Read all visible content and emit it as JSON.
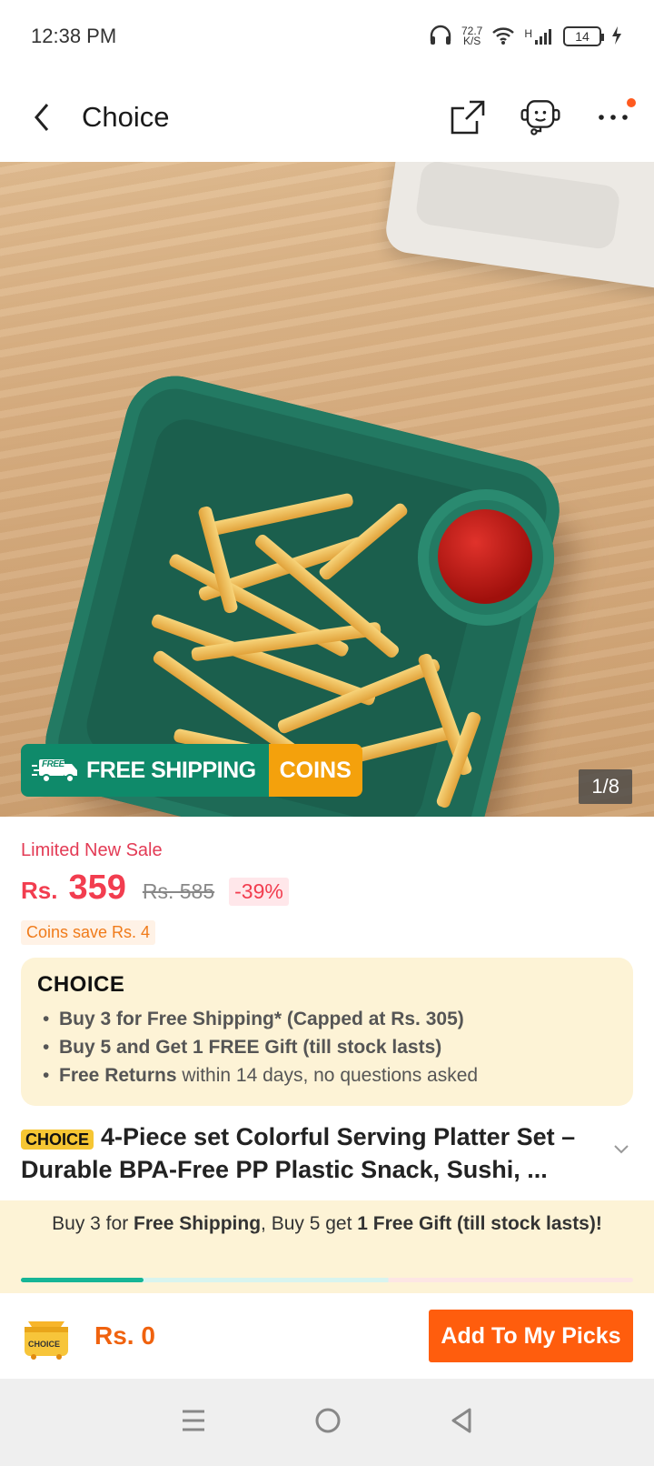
{
  "status_bar": {
    "time": "12:38 PM",
    "speed_value": "72.7",
    "speed_unit": "K/S",
    "network": "H",
    "battery": "14"
  },
  "navbar": {
    "title": "Choice"
  },
  "gallery": {
    "counter": "1/8",
    "free_shipping_label": "FREE SHIPPING",
    "free_tag": "FREE",
    "coins_label": "COINS"
  },
  "pricing": {
    "sale_label": "Limited New Sale",
    "currency": "Rs.",
    "price": "359",
    "original_price": "Rs. 585",
    "discount": "-39%",
    "coins_save": "Coins save Rs. 4"
  },
  "choice_box": {
    "logo": "CHOICE",
    "items": [
      {
        "bold": "Buy 3 for  Free Shipping* (Capped at Rs. 305)",
        "rest": ""
      },
      {
        "bold": "Buy 5 and Get 1 FREE Gift (till stock lasts)",
        "rest": ""
      },
      {
        "bold": "Free Returns",
        "rest": " within 14 days, no questions asked"
      }
    ]
  },
  "product": {
    "tag": "CHOICE",
    "title": "4-Piece set Colorful Serving Platter Set – Durable BPA-Free PP Plastic Snack, Sushi, ..."
  },
  "promo_banner": {
    "part1": "Buy 3 for ",
    "bold1": "Free Shipping",
    "part2": ", Buy 5 get ",
    "bold2": "1 Free Gift (till stock lasts)!",
    "progress": 0.2
  },
  "cart_bar": {
    "cart_icon_label": "CHOICE",
    "total": "Rs. 0",
    "add_button": "Add To My Picks"
  },
  "colors": {
    "accent": "#ff5d0d",
    "price": "#f23d4f",
    "green": "#0f8a6a",
    "coins": "#f4a10c"
  }
}
